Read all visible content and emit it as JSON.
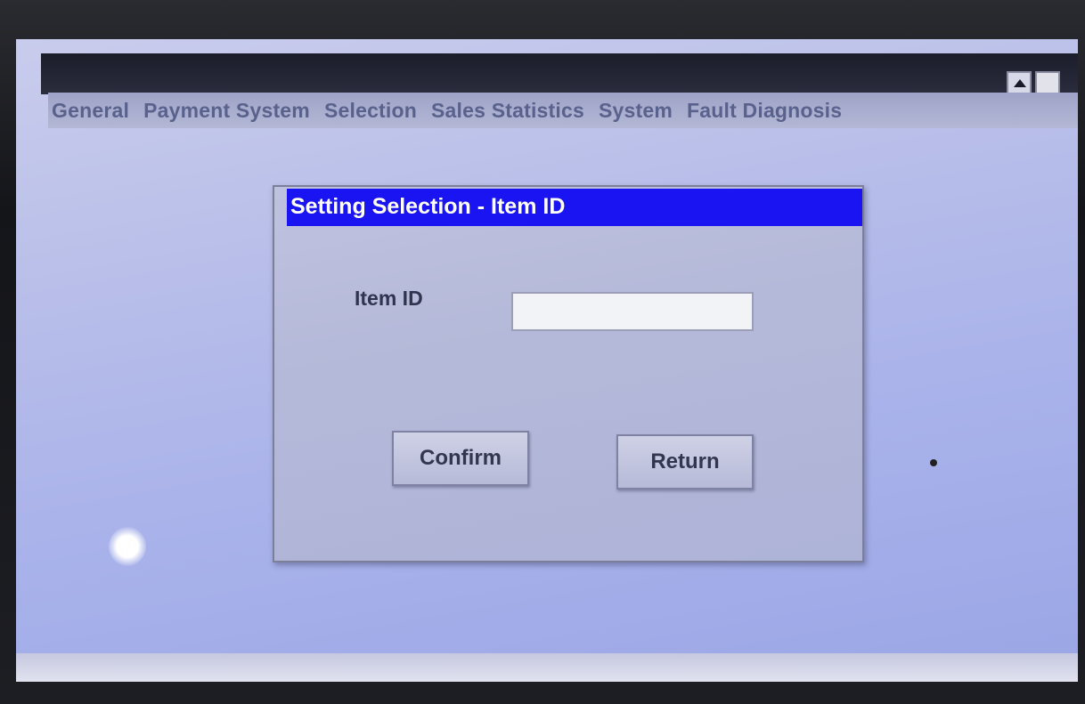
{
  "menu": {
    "items": [
      "General",
      "Payment System",
      "Selection",
      "Sales Statistics",
      "System",
      "Fault Diagnosis"
    ]
  },
  "window_buttons": {
    "up_icon": "triangle-up-icon",
    "square_icon": "square-icon"
  },
  "dialog": {
    "title": "Setting Selection - Item ID",
    "field_label": "Item ID",
    "field_value": "",
    "confirm_label": "Confirm",
    "return_label": "Return"
  },
  "colors": {
    "dialog_title_bg": "#1a14f2",
    "screen_bg": "#b9bfe9",
    "menu_text": "#59618d"
  }
}
